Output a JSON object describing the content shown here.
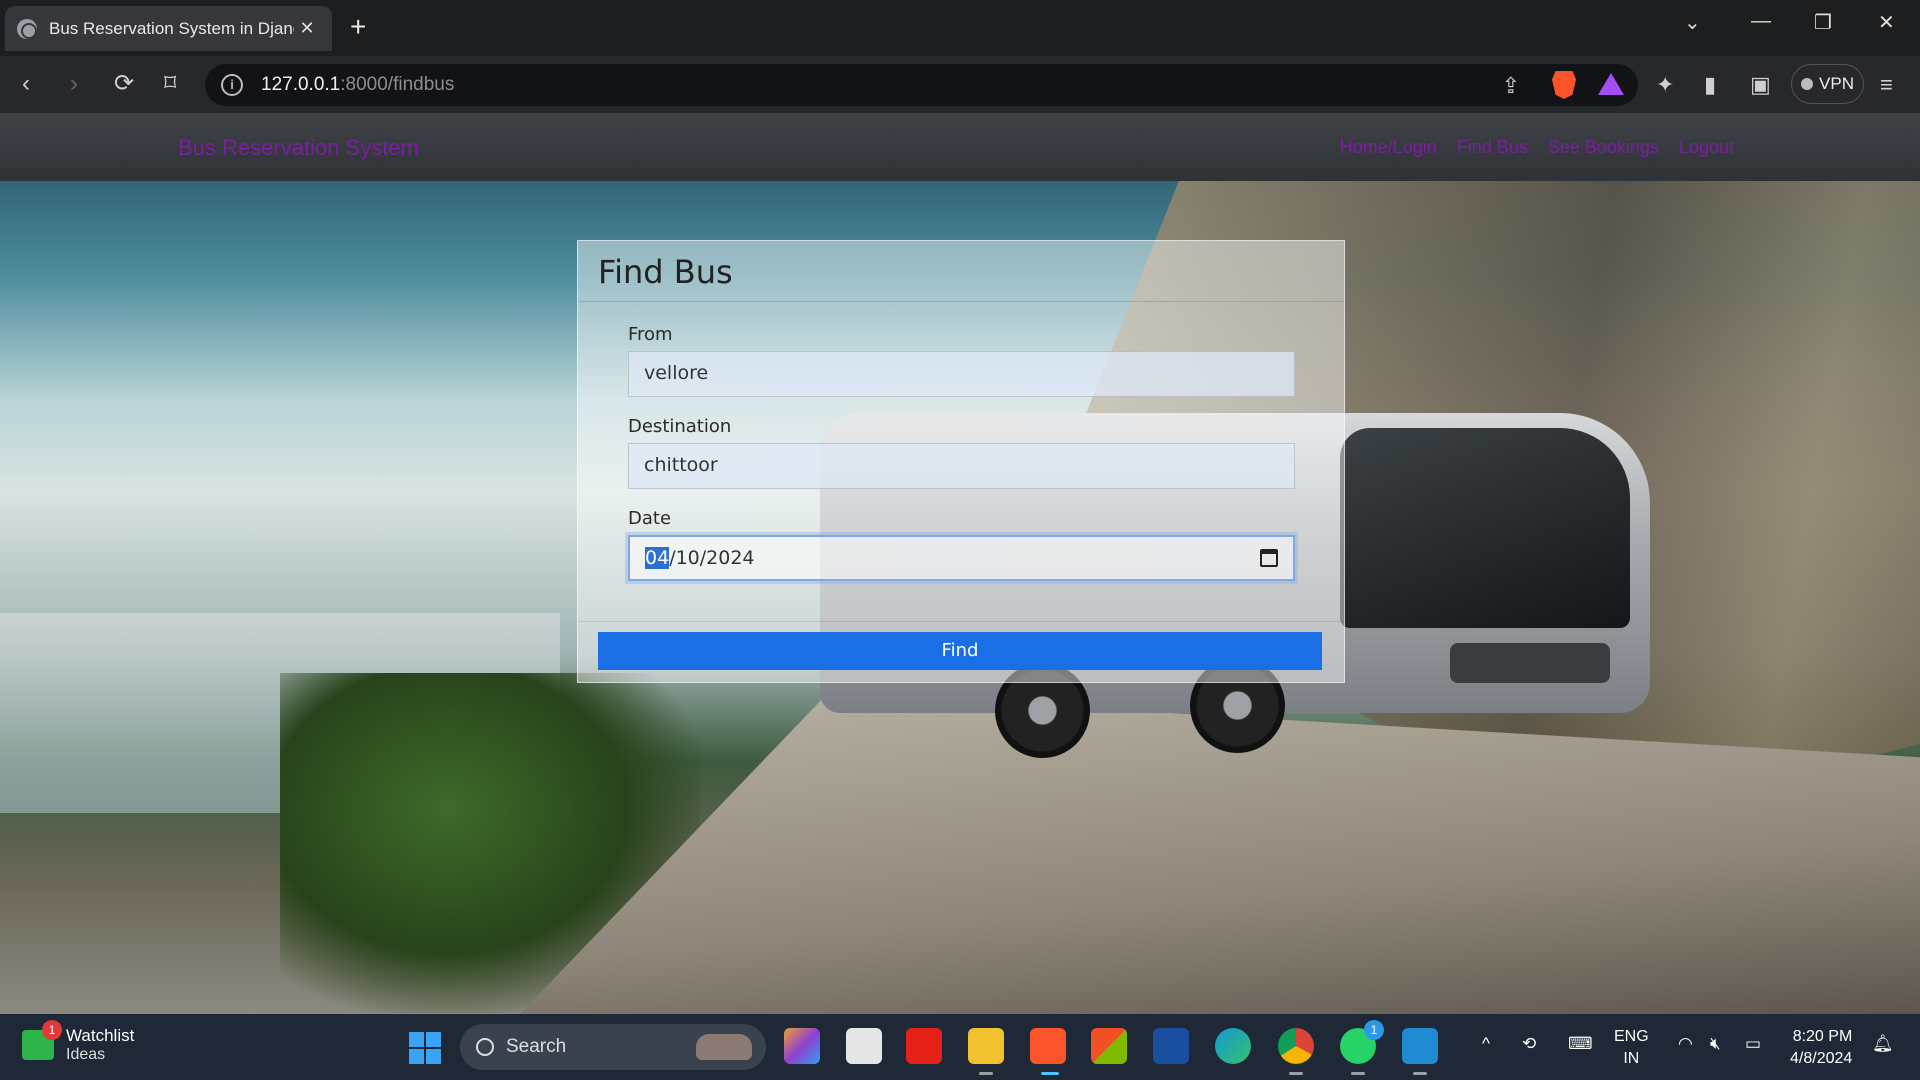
{
  "browser": {
    "tab_title": "Bus Reservation System in Djang",
    "new_tab": "+",
    "url_host": "127.0.0.1",
    "url_path": ":8000/findbus",
    "vpn_label": "VPN"
  },
  "navbar": {
    "brand": "Bus Reservation System",
    "links": [
      "Home/Login",
      "Find Bus",
      "See Bookings",
      "Logout"
    ]
  },
  "form": {
    "title": "Find Bus",
    "from_label": "From",
    "from_value": "vellore",
    "destination_label": "Destination",
    "destination_value": "chittoor",
    "date_label": "Date",
    "date_month": "04",
    "date_rest": "/10/2024",
    "submit_label": "Find"
  },
  "taskbar": {
    "widget_title": "Watchlist",
    "widget_subtitle": "Ideas",
    "widget_badge": "1",
    "search_placeholder": "Search",
    "whatsapp_badge": "1",
    "lang_line1": "ENG",
    "lang_line2": "IN",
    "time": "8:20 PM",
    "date": "4/8/2024"
  }
}
